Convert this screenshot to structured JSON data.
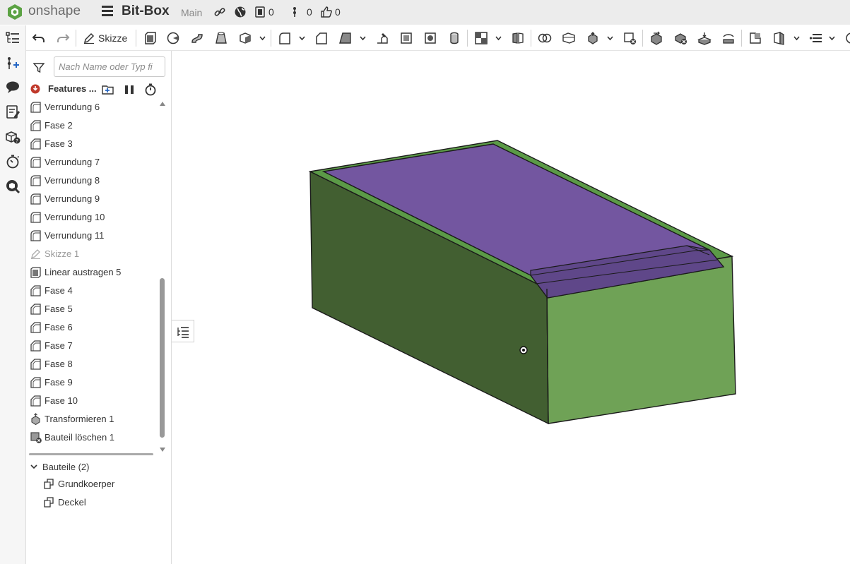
{
  "header": {
    "brand": "onshape",
    "doc_title": "Bit-Box",
    "branch": "Main",
    "versions_count": "0",
    "branches_count": "0",
    "likes_count": "0",
    "colors": {
      "brand_green": "#5ba243",
      "bar_bg": "#ececec"
    }
  },
  "toolbar": {
    "sketch_label": "Skizze"
  },
  "panel": {
    "search_placeholder": "Nach Name oder Typ fi",
    "features_title": "Features ...",
    "features": [
      {
        "label": "Verrundung 6",
        "icon": "fillet-icon"
      },
      {
        "label": "Fase 2",
        "icon": "chamfer-icon"
      },
      {
        "label": "Fase 3",
        "icon": "chamfer-icon"
      },
      {
        "label": "Verrundung 7",
        "icon": "fillet-icon"
      },
      {
        "label": "Verrundung 8",
        "icon": "fillet-icon"
      },
      {
        "label": "Verrundung 9",
        "icon": "fillet-icon"
      },
      {
        "label": "Verrundung 10",
        "icon": "fillet-icon"
      },
      {
        "label": "Verrundung 11",
        "icon": "fillet-icon"
      },
      {
        "label": "Skizze 1",
        "icon": "sketch-icon"
      },
      {
        "label": "Linear austragen 5",
        "icon": "extrude-icon"
      },
      {
        "label": "Fase 4",
        "icon": "chamfer-icon"
      },
      {
        "label": "Fase 5",
        "icon": "chamfer-icon"
      },
      {
        "label": "Fase 6",
        "icon": "chamfer-icon"
      },
      {
        "label": "Fase 7",
        "icon": "chamfer-icon"
      },
      {
        "label": "Fase 8",
        "icon": "chamfer-icon"
      },
      {
        "label": "Fase 9",
        "icon": "chamfer-icon"
      },
      {
        "label": "Fase 10",
        "icon": "chamfer-icon"
      },
      {
        "label": "Transformieren 1",
        "icon": "transform-icon"
      },
      {
        "label": "Bauteil löschen 1",
        "icon": "delete-part-icon"
      }
    ],
    "parts_title": "Bauteile (2)",
    "parts": [
      {
        "label": "Grundkoerper"
      },
      {
        "label": "Deckel"
      }
    ]
  },
  "model": {
    "colors": {
      "body_top": "#5b9a47",
      "body_front": "#425f31",
      "body_right": "#6fa256",
      "lid": "#7356a0",
      "lid_slot": "#5f4789",
      "edge": "#1a1a1a"
    }
  }
}
